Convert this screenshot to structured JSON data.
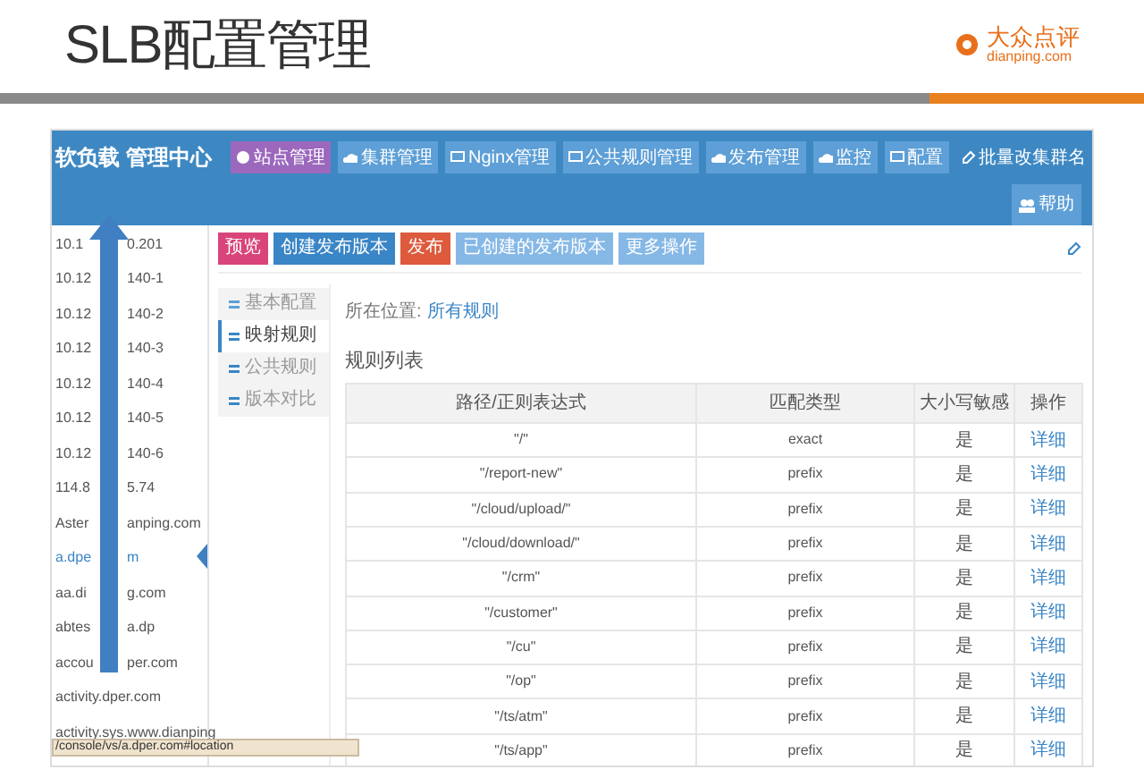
{
  "slide": {
    "title": "SLB配置管理",
    "logo_text": "大众点评",
    "logo_url": "dianping.com"
  },
  "app": {
    "title": "软负载 管理中心",
    "nav": [
      {
        "label": "站点管理",
        "kind": "button",
        "selected": true
      },
      {
        "label": "集群管理",
        "kind": "button",
        "selected": false
      },
      {
        "label": "Nginx管理",
        "kind": "button",
        "selected": false
      },
      {
        "label": "公共规则管理",
        "kind": "button",
        "selected": false
      },
      {
        "label": "发布管理",
        "kind": "button",
        "selected": false
      },
      {
        "label": "监控",
        "kind": "button",
        "selected": false
      },
      {
        "label": "配置",
        "kind": "button",
        "selected": false
      },
      {
        "label": "批量改集群名",
        "kind": "link"
      }
    ],
    "help": "帮助",
    "sidebar": [
      {
        "kind": "split",
        "start": "10.1",
        "end": "0.201",
        "selected": false
      },
      {
        "kind": "split",
        "start": "10.12",
        "end": "140-1",
        "selected": false
      },
      {
        "kind": "split",
        "start": "10.12",
        "end": "140-2",
        "selected": false
      },
      {
        "kind": "split",
        "start": "10.12",
        "end": "140-3",
        "selected": false
      },
      {
        "kind": "split",
        "start": "10.12",
        "end": "140-4",
        "selected": false
      },
      {
        "kind": "split",
        "start": "10.12",
        "end": "140-5",
        "selected": false
      },
      {
        "kind": "split",
        "start": "10.12",
        "end": "140-6",
        "selected": false
      },
      {
        "kind": "split",
        "start": "114.8",
        "end": "5.74",
        "selected": false
      },
      {
        "kind": "split",
        "start": "Aster",
        "end": "anping.com",
        "selected": false
      },
      {
        "kind": "split",
        "start": "a.dpe",
        "end": "m",
        "selected": true
      },
      {
        "kind": "split",
        "start": "aa.di",
        "end": "g.com",
        "selected": false
      },
      {
        "kind": "split",
        "start": "abtes",
        "end": "a.dp",
        "selected": false
      },
      {
        "kind": "split",
        "start": "accou",
        "end": "per.com",
        "selected": false
      },
      {
        "kind": "full",
        "text": "activity.dper.com",
        "selected": false
      },
      {
        "kind": "full",
        "text": "activity.sys.www.dianping",
        "selected": false
      }
    ],
    "status_url": "/console/vs/a.dper.com#location",
    "actions": [
      {
        "label": "预览",
        "color": "#d9447a"
      },
      {
        "label": "创建发布版本",
        "color": "#3a85c6"
      },
      {
        "label": "发布",
        "color": "#dd5a3c"
      },
      {
        "label": "已创建的发布版本",
        "color": "#86b8e6"
      },
      {
        "label": "更多操作",
        "color": "#86b8e6"
      }
    ],
    "tabs": [
      {
        "label": "基本配置",
        "selected": false
      },
      {
        "label": "映射规则",
        "selected": true
      },
      {
        "label": "公共规则",
        "selected": false
      },
      {
        "label": "版本对比",
        "selected": false
      }
    ],
    "breadcrumb": {
      "prefix": "所在位置:",
      "link": "所有规则"
    },
    "table": {
      "title": "规则列表",
      "columns": [
        "路径/正则表达式",
        "匹配类型",
        "大小写敏感",
        "操作"
      ],
      "rows": [
        [
          "\"/\"",
          "exact",
          "是",
          "详细"
        ],
        [
          "\"/report-new\"",
          "prefix",
          "是",
          "详细"
        ],
        [
          "\"/cloud/upload/\"",
          "prefix",
          "是",
          "详细"
        ],
        [
          "\"/cloud/download/\"",
          "prefix",
          "是",
          "详细"
        ],
        [
          "\"/crm\"",
          "prefix",
          "是",
          "详细"
        ],
        [
          "\"/customer\"",
          "prefix",
          "是",
          "详细"
        ],
        [
          "\"/cu\"",
          "prefix",
          "是",
          "详细"
        ],
        [
          "\"/op\"",
          "prefix",
          "是",
          "详细"
        ],
        [
          "\"/ts/atm\"",
          "prefix",
          "是",
          "详细"
        ],
        [
          "\"/ts/app\"",
          "prefix",
          "是",
          "详细"
        ]
      ]
    }
  }
}
